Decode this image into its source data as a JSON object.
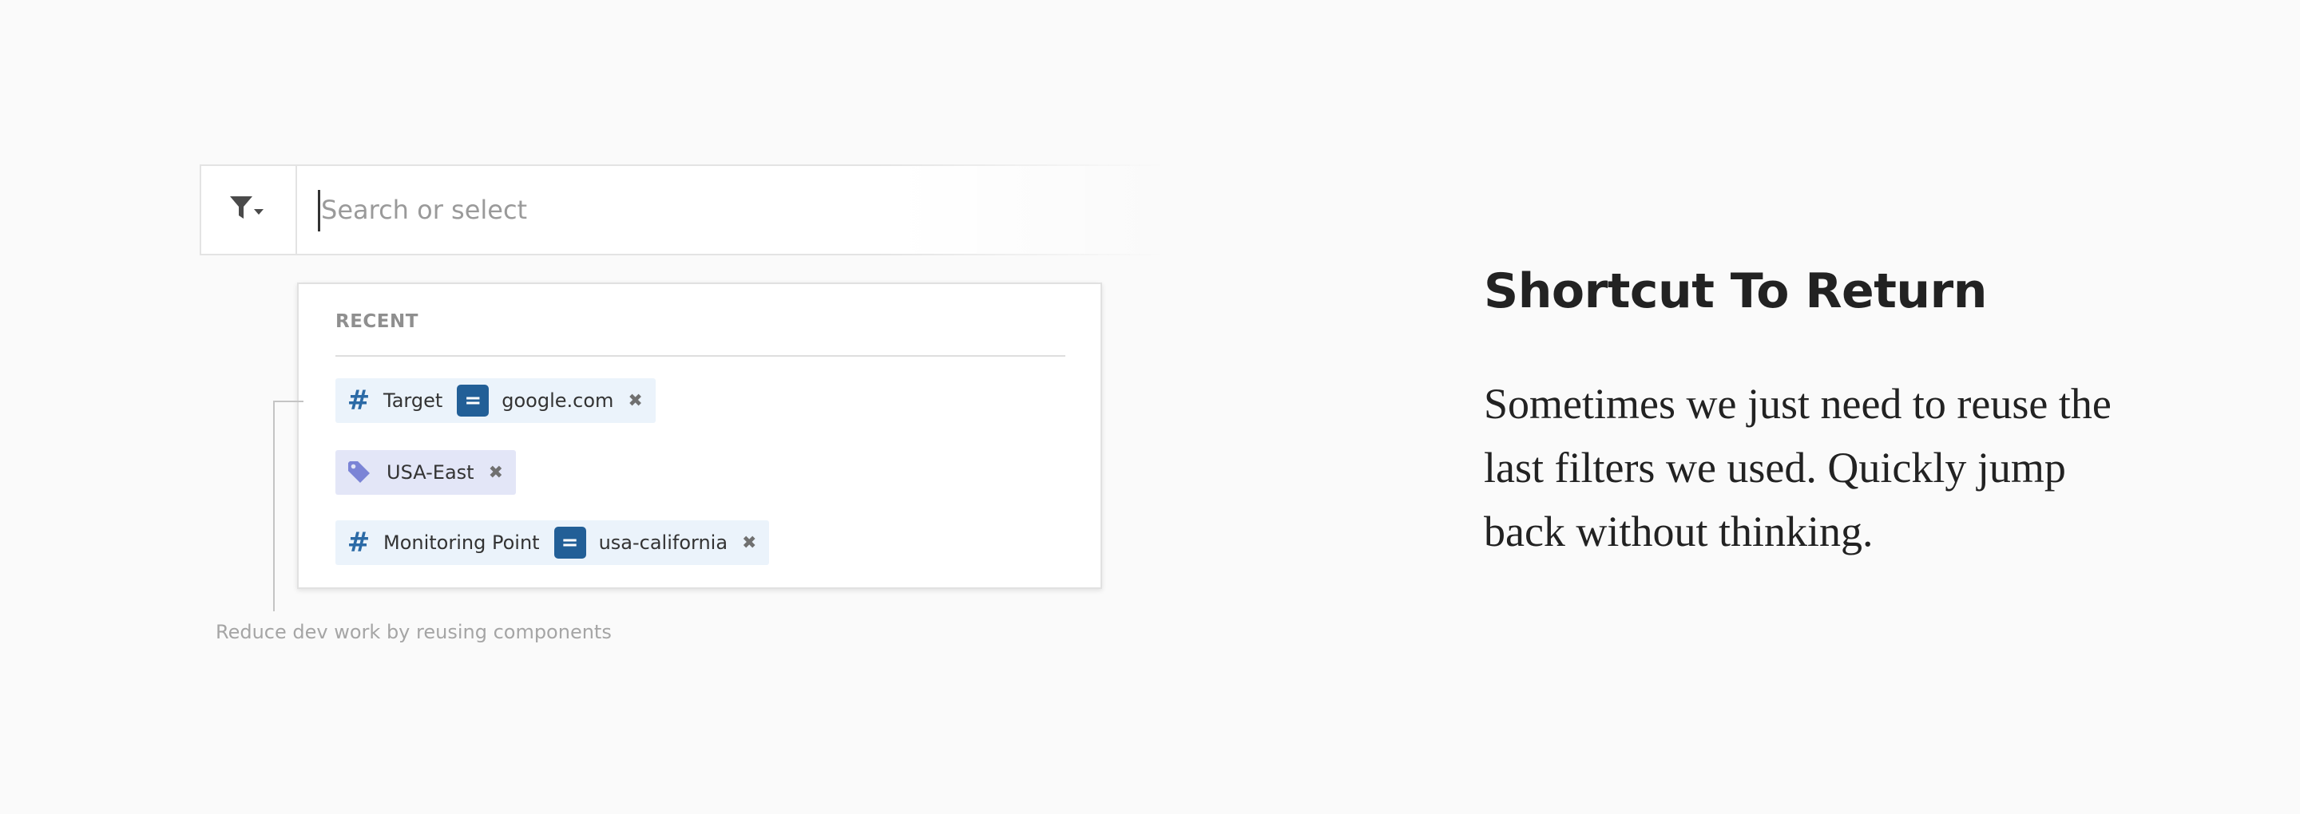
{
  "search": {
    "placeholder": "Search or select"
  },
  "dropdown": {
    "heading": "RECENT",
    "items": [
      {
        "type": "attribute",
        "icon": "hash-icon",
        "key": "Target",
        "operator": "=",
        "value": "google.com"
      },
      {
        "type": "tag",
        "icon": "tag-icon",
        "label": "USA-East"
      },
      {
        "type": "attribute",
        "icon": "hash-icon",
        "key": "Monitoring Point",
        "operator": "=",
        "value": "usa-california"
      }
    ]
  },
  "annotation": {
    "text": "Reduce dev work by reusing components"
  },
  "section": {
    "title": "Shortcut To Return",
    "body": "Sometimes we just need to reuse the last filters we used. Quickly jump back without thinking."
  },
  "colors": {
    "background": "#fafafa",
    "chip_bg": "#ebf3fb",
    "tag_chip_bg": "#e3e6f7",
    "operator_bg": "#225f97",
    "hash": "#2b6aa6",
    "tag_icon": "#7b84d6"
  }
}
